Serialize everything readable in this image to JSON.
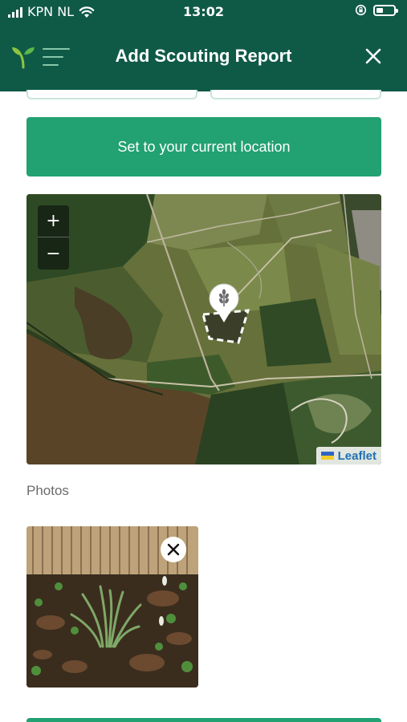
{
  "status_bar": {
    "carrier": "KPN NL",
    "time": "13:02",
    "icons": [
      "signal-icon",
      "wifi-icon",
      "orientation-lock-icon",
      "battery-icon"
    ]
  },
  "header": {
    "title": "Add Scouting Report",
    "logo_icon": "sprout-logo-icon",
    "menu_icon": "menu-icon",
    "close_icon": "close-icon",
    "background_color": "#0f5a47",
    "text_color": "#ffffff"
  },
  "location": {
    "button_label": "Set to your current location",
    "button_color": "#22a173"
  },
  "map": {
    "zoom_in": "+",
    "zoom_out": "−",
    "attribution": "Leaflet",
    "marker_icon": "wheat-pin-icon"
  },
  "photos": {
    "label": "Photos",
    "items": [
      {
        "remove_icon": "close-icon"
      }
    ]
  }
}
